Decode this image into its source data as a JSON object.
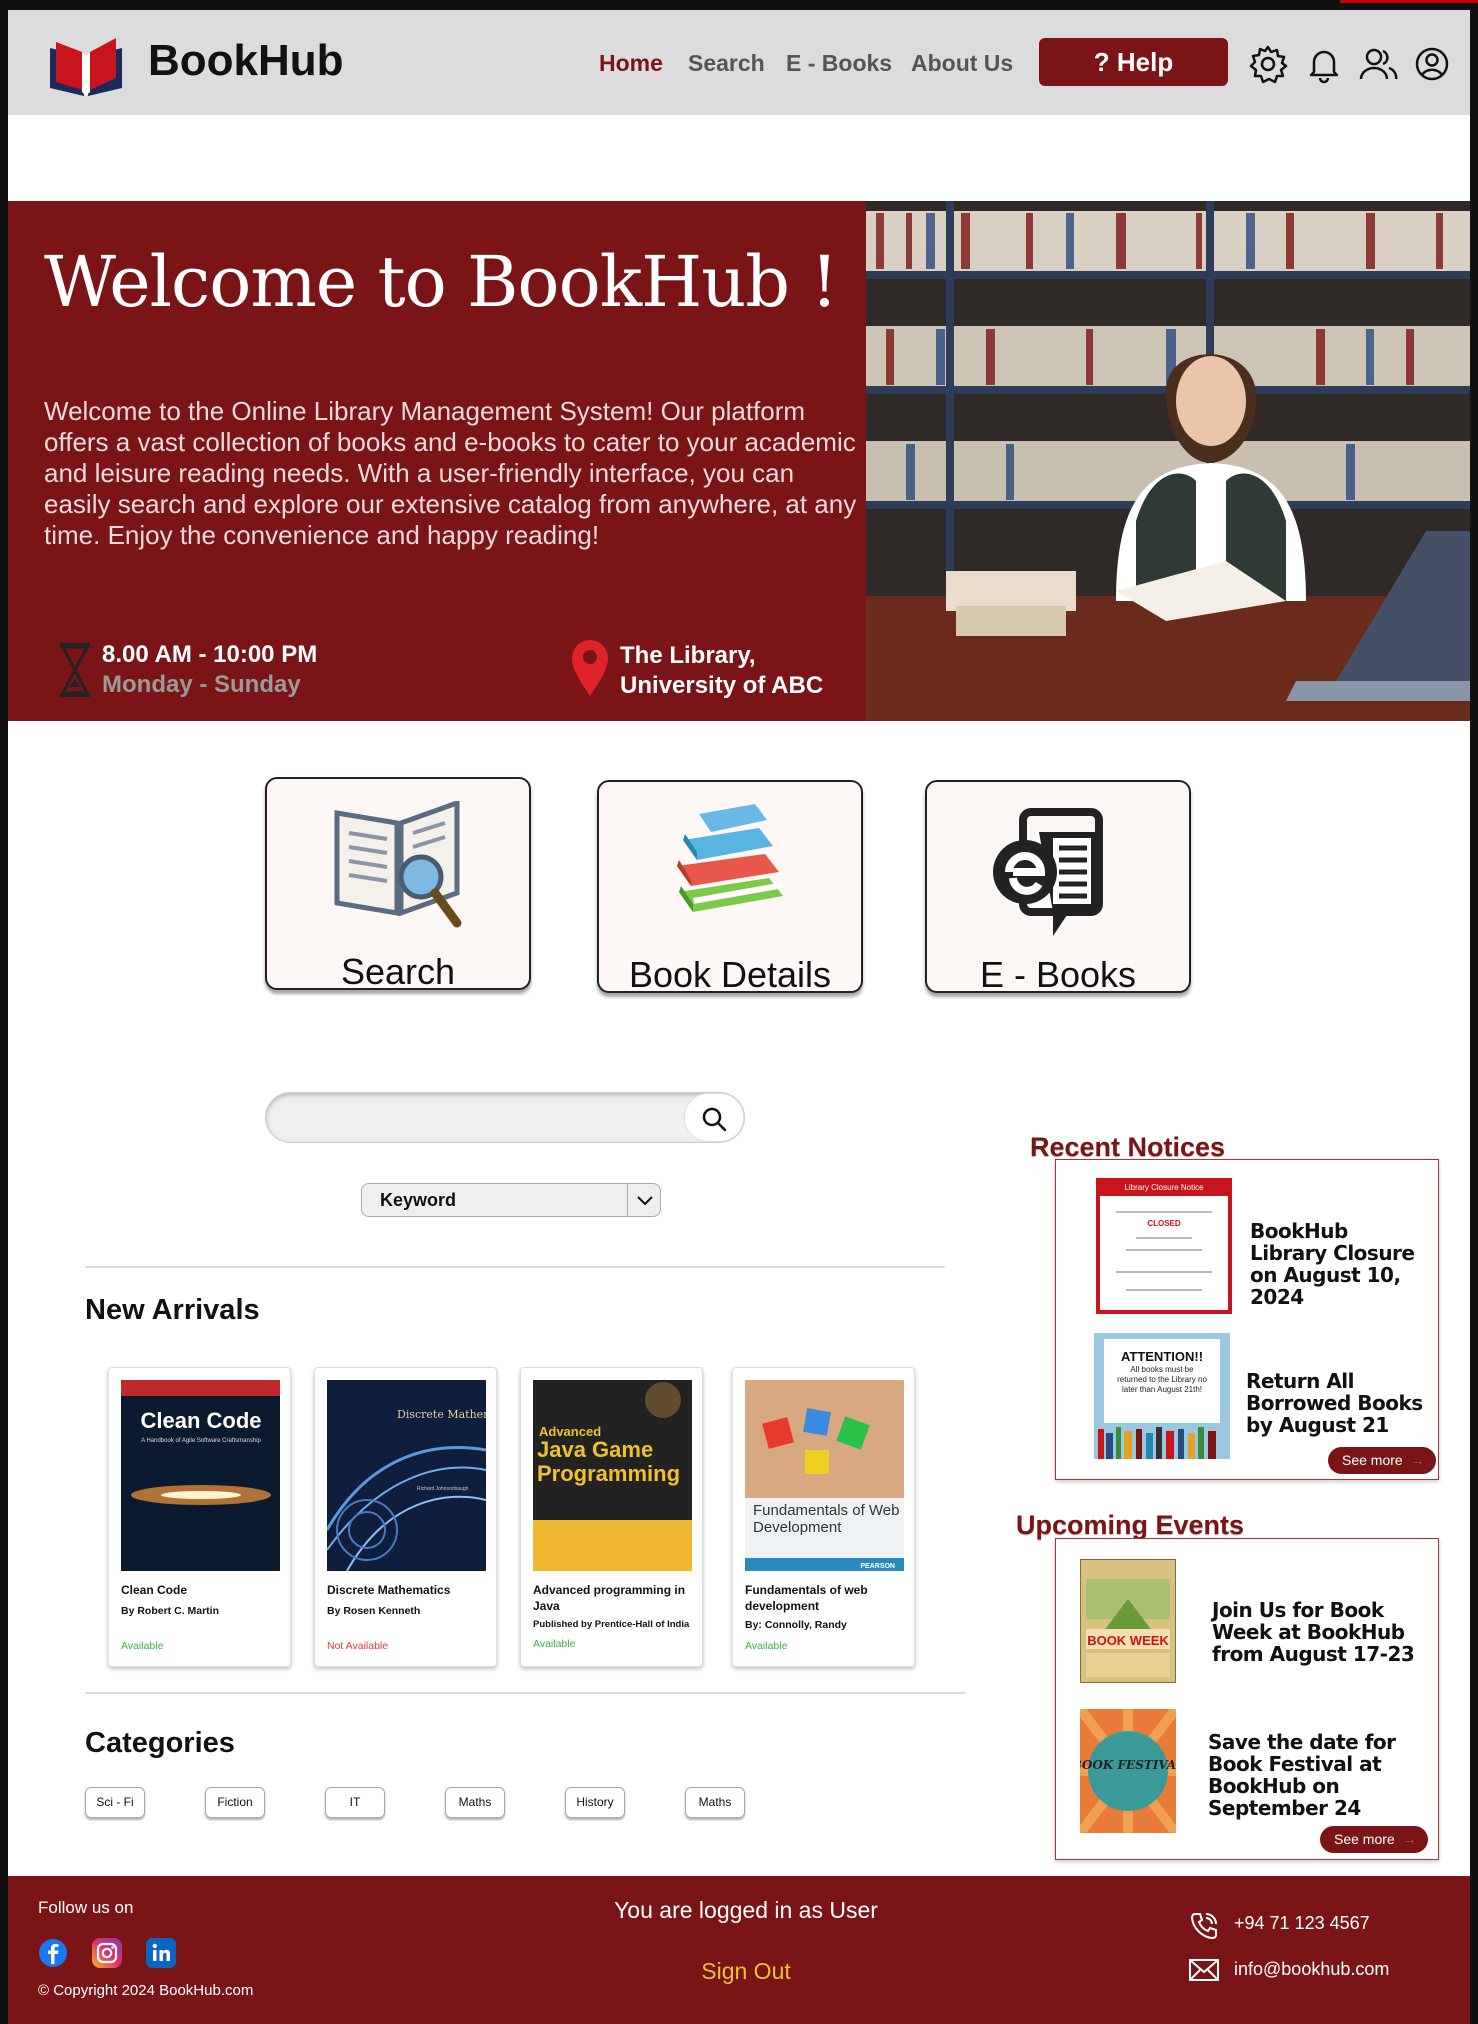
{
  "header": {
    "brand": "BookHub",
    "nav": [
      "Home",
      "Search",
      "E - Books",
      "About Us"
    ],
    "help_label": "? Help"
  },
  "hero": {
    "title": "Welcome to BookHub !",
    "description": "Welcome to the Online Library Management System! Our platform offers a vast collection of books and e-books to cater to your academic and leisure reading needs. With a user-friendly interface, you can easily search and explore our extensive catalog from anywhere, at any time. Enjoy the convenience and happy reading!",
    "hours": "8.00 AM - 10:00 PM",
    "days": "Monday - Sunday",
    "location_line1": "The Library,",
    "location_line2": "University of ABC"
  },
  "features": [
    {
      "label": "Search"
    },
    {
      "label": "Book Details"
    },
    {
      "label": "E - Books"
    }
  ],
  "search": {
    "placeholder": "",
    "filter_selected": "Keyword"
  },
  "new_arrivals": {
    "title": "New Arrivals",
    "books": [
      {
        "title": "Clean Code",
        "author": "By Robert C. Martin",
        "extra": "",
        "status": "Available",
        "cover_title": "Clean Code",
        "cover_sub": "A Handbook of Agile Software Craftsmanship"
      },
      {
        "title": "Discrete Mathematics",
        "author": "By Rosen Kenneth",
        "extra": "",
        "status": "Not Available",
        "cover_title": "Discrete Mathematics",
        "cover_sub": "Richard Johnsonbaugh"
      },
      {
        "title": "Advanced programming in Java",
        "author": "Published by Prentice-Hall of India",
        "extra": "",
        "status": "Available",
        "cover_title": "Java Game Programming",
        "cover_sub": "Advanced"
      },
      {
        "title": "Fundamentals of web development",
        "author": "By: Connolly, Randy",
        "extra": "",
        "status": "Available",
        "cover_title": "Fundamentals of Web Development",
        "cover_sub": "PEARSON"
      }
    ]
  },
  "categories": {
    "title": "Categories",
    "items": [
      "Sci - Fi",
      "Fiction",
      "IT",
      "Maths",
      "History",
      "Maths"
    ]
  },
  "notices": {
    "title": "Recent Notices",
    "items": [
      {
        "text": "BookHub Library Closure on August 10, 2024",
        "poster_head": "Library Closure Notice",
        "poster_closed": "CLOSED"
      },
      {
        "text": "Return All Borrowed Books by August 21",
        "poster_head": "ATTENTION!!",
        "poster_body": "All books must be returned to the Library no later than August 21th!"
      }
    ],
    "see_more": "See more"
  },
  "events": {
    "title": "Upcoming Events",
    "items": [
      {
        "text": "Join Us for Book Week at BookHub from August 17-23",
        "poster": "BOOK WEEK"
      },
      {
        "text": "Save the date for Book Festival at BookHub on September 24",
        "poster": "BOOK FESTIVAL"
      }
    ],
    "see_more": "See more"
  },
  "footer": {
    "follow": "Follow us on",
    "copyright": "© Copyright 2024 BookHub.com",
    "logged_in": "You are logged in as User",
    "sign_out": "Sign Out",
    "phone": "+94 71 123 4567",
    "email": "info@bookhub.com"
  },
  "colors": {
    "brand": "#7a1416",
    "header_bg": "#dcdcdc",
    "available": "#3cb043",
    "not_available": "#e53935",
    "signout": "#e8c230"
  }
}
